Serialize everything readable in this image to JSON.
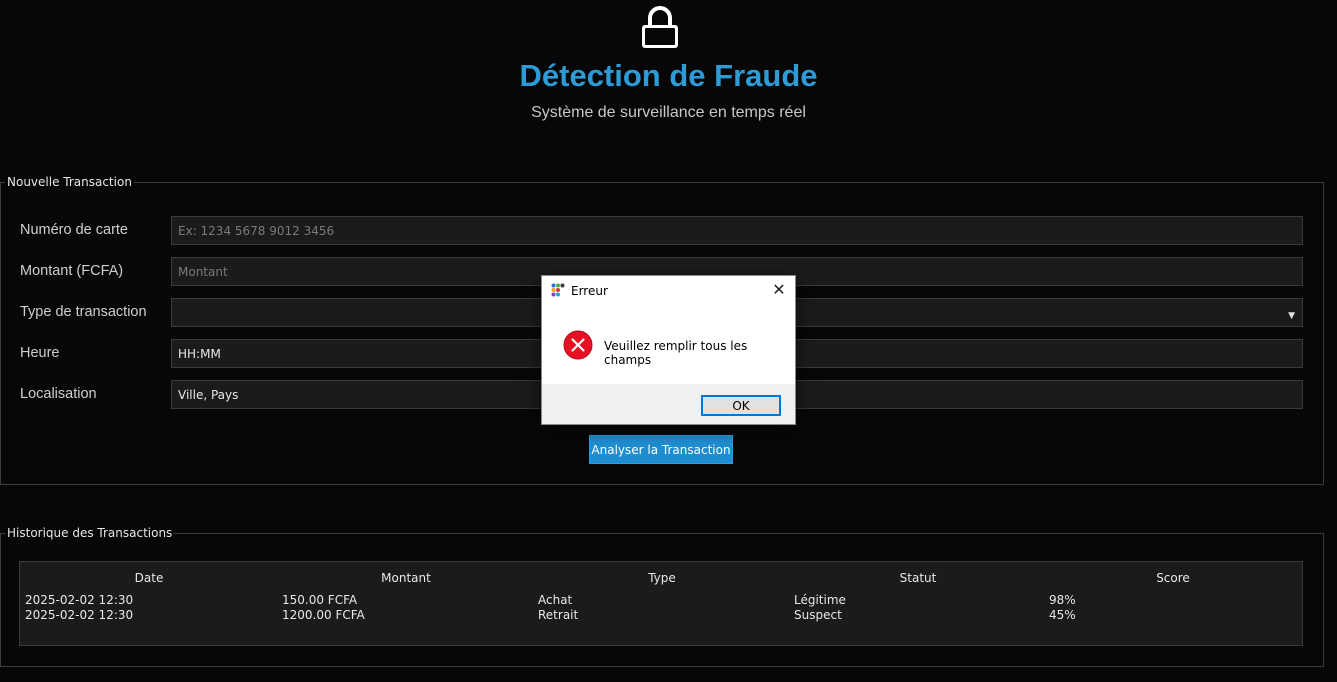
{
  "header": {
    "icon": "lock-icon",
    "title": "Détection de Fraude",
    "subtitle": "Système de surveillance en temps réel"
  },
  "form": {
    "group_title": "Nouvelle Transaction",
    "fields": [
      {
        "label": "Numéro de carte",
        "value": "",
        "placeholder": "Ex: 1234 5678 9012 3456"
      },
      {
        "label": "Montant (FCFA)",
        "value": "",
        "placeholder": "Montant"
      },
      {
        "label": "Type de transaction",
        "value": ""
      },
      {
        "label": "Heure",
        "value": "HH:MM",
        "placeholder": ""
      },
      {
        "label": "Localisation",
        "value": "Ville, Pays",
        "placeholder": ""
      }
    ],
    "submit_label": "Analyser la Transaction"
  },
  "history": {
    "group_title": "Historique des Transactions",
    "columns": [
      "Date",
      "Montant",
      "Type",
      "Statut",
      "Score"
    ],
    "rows": [
      [
        "2025-02-02 12:30",
        "150.00 FCFA",
        "Achat",
        "Légitime",
        "98%"
      ],
      [
        "2025-02-02 12:30",
        "1200.00 FCFA",
        "Retrait",
        "Suspect",
        "45%"
      ]
    ]
  },
  "dialog": {
    "title": "Erreur",
    "icon": "error-icon",
    "message": "Veuillez remplir tous les champs",
    "ok_label": "OK"
  },
  "colors": {
    "background": "#070707",
    "accent": "#2f9bd6",
    "button": "#1f8ed0",
    "error": "#e81123"
  }
}
